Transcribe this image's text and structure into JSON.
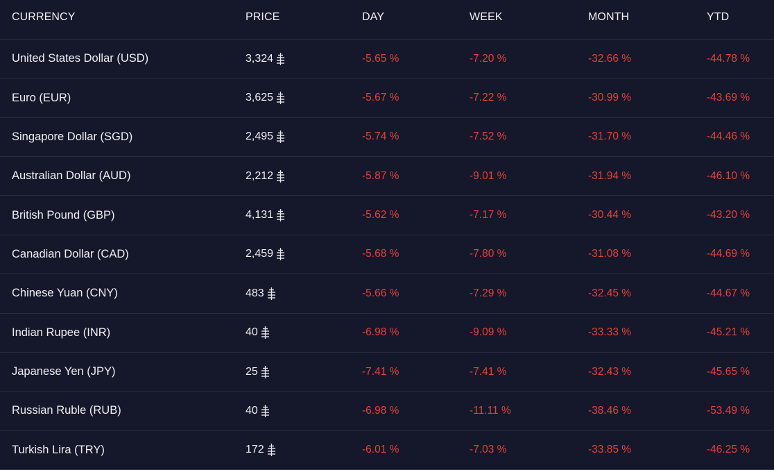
{
  "columns": {
    "currency": "CURRENCY",
    "price": "PRICE",
    "day": "DAY",
    "week": "WEEK",
    "month": "MONTH",
    "ytd": "YTD"
  },
  "price_icon": "currency-symbol-icon",
  "colors": {
    "background": "#15172a",
    "negative": "#e8413a",
    "divider": "#2a2d40"
  },
  "rows": [
    {
      "name": "United States Dollar (USD)",
      "price": "3,324",
      "day": "-5.65 %",
      "week": "-7.20 %",
      "month": "-32.66 %",
      "ytd": "-44.78 %"
    },
    {
      "name": "Euro (EUR)",
      "price": "3,625",
      "day": "-5.67 %",
      "week": "-7.22 %",
      "month": "-30.99 %",
      "ytd": "-43.69 %"
    },
    {
      "name": "Singapore Dollar (SGD)",
      "price": "2,495",
      "day": "-5.74 %",
      "week": "-7.52 %",
      "month": "-31.70 %",
      "ytd": "-44.46 %"
    },
    {
      "name": "Australian Dollar (AUD)",
      "price": "2,212",
      "day": "-5.87 %",
      "week": "-9.01 %",
      "month": "-31.94 %",
      "ytd": "-46.10 %"
    },
    {
      "name": "British Pound (GBP)",
      "price": "4,131",
      "day": "-5.62 %",
      "week": "-7.17 %",
      "month": "-30.44 %",
      "ytd": "-43.20 %"
    },
    {
      "name": "Canadian Dollar (CAD)",
      "price": "2,459",
      "day": "-5.68 %",
      "week": "-7.80 %",
      "month": "-31.08 %",
      "ytd": "-44.69 %"
    },
    {
      "name": "Chinese Yuan (CNY)",
      "price": "483",
      "day": "-5.66 %",
      "week": "-7.29 %",
      "month": "-32.45 %",
      "ytd": "-44.67 %"
    },
    {
      "name": "Indian Rupee (INR)",
      "price": "40",
      "day": "-6.98 %",
      "week": "-9.09 %",
      "month": "-33.33 %",
      "ytd": "-45.21 %"
    },
    {
      "name": "Japanese Yen (JPY)",
      "price": "25",
      "day": "-7.41 %",
      "week": "-7.41 %",
      "month": "-32.43 %",
      "ytd": "-45.65 %"
    },
    {
      "name": "Russian Ruble (RUB)",
      "price": "40",
      "day": "-6.98 %",
      "week": "-11.11 %",
      "month": "-38.46 %",
      "ytd": "-53.49 %"
    },
    {
      "name": "Turkish Lira (TRY)",
      "price": "172",
      "day": "-6.01 %",
      "week": "-7.03 %",
      "month": "-33.85 %",
      "ytd": "-46.25 %"
    }
  ]
}
